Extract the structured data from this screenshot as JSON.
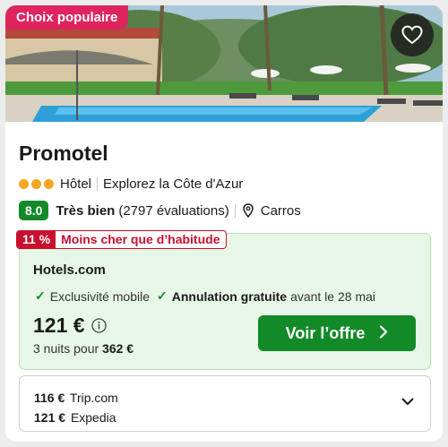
{
  "badge": "Choix populaire",
  "hotel": {
    "name": "Promotel",
    "stars": 3,
    "type": "Hôtel",
    "tagline": "Explorez la Côte d'Azur",
    "score": "8.0",
    "rating_word": "Très bien",
    "reviews": "(2797 évaluations)",
    "location": "Carros"
  },
  "offer": {
    "discount_pct": "11 %",
    "discount_text": "Moins cher que d’habitude",
    "provider": "Hotels.com",
    "perk1": "Exclusivité mobile",
    "perk2_strong": "Annulation gratuite",
    "perk2_rest": "avant le 28 mai",
    "price": "121 €",
    "nights_label": "3 nuits pour",
    "total": "362 €",
    "cta": "Voir l’offre"
  },
  "others": [
    {
      "price": "116 €",
      "site": "Trip.com"
    },
    {
      "price": "121 €",
      "site": "Expedia"
    }
  ],
  "colors": {
    "badge": "#e0245e",
    "score": "#128a27",
    "cta": "#128a27",
    "discount": "#c8102e",
    "offer_bg": "#e7f6e6",
    "stars": "#f5a623"
  },
  "icons": [
    "heart-icon",
    "map-pin-icon",
    "info-icon",
    "check-icon",
    "chevron-right-icon",
    "chevron-down-icon"
  ]
}
